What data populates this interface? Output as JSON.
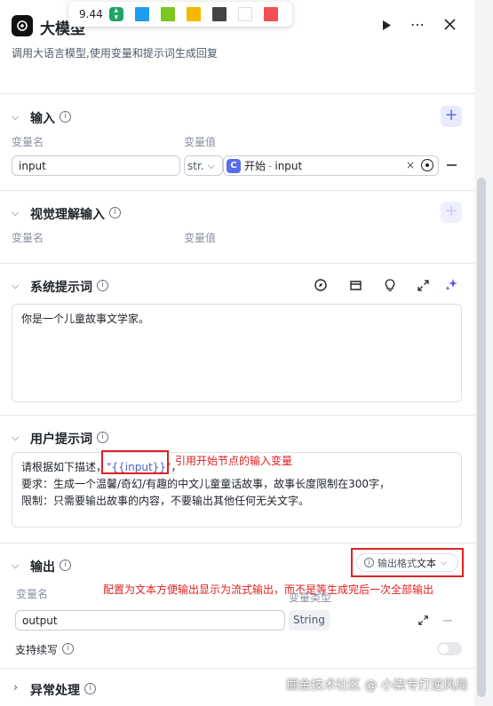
{
  "header": {
    "title": "大模型",
    "description": "调用大语言模型,使用变量和提示词生成回复"
  },
  "toolbar": {
    "value": "9.44",
    "colors": [
      "#1e9cf0",
      "#7ec620",
      "#f5b800",
      "#444444",
      "#ffffff",
      "#f05050"
    ]
  },
  "input_section": {
    "title": "输入",
    "col_name": "变量名",
    "col_value": "变量值",
    "var_name": "input",
    "type_short": "str.",
    "ref_node": "开始",
    "ref_sep": "-",
    "ref_var": "input"
  },
  "vision_section": {
    "title": "视觉理解输入",
    "col_name": "变量名",
    "col_value": "变量值"
  },
  "system_prompt": {
    "title": "系统提示词",
    "text": "你是一个儿童故事文学家。"
  },
  "user_prompt": {
    "title": "用户提示词",
    "line1_prefix": "请根据如下描述，",
    "line1_var": "\"{{input}}\"",
    "line1_suffix": "，",
    "line2": "要求：生成一个温馨/奇幻/有趣的中文儿童童话故事，故事长度限制在300字，",
    "line3": "限制：只需要输出故事的内容，不要输出其他任何无关文字。",
    "annotation": "引用开始节点的输入变量"
  },
  "output_section": {
    "title": "输出",
    "format_label": "输出格式",
    "format_value": "文本",
    "annotation": "配置为文本方便输出显示为流式输出，而不是等生成完后一次全部输出",
    "col_name": "变量名",
    "col_type": "变量类型",
    "var_name": "output",
    "var_type": "String",
    "continue_label": "支持续写"
  },
  "exception_section": {
    "title": "异常处理"
  },
  "watermark": "掘金技术社区 @ 小柒专打逆风局"
}
